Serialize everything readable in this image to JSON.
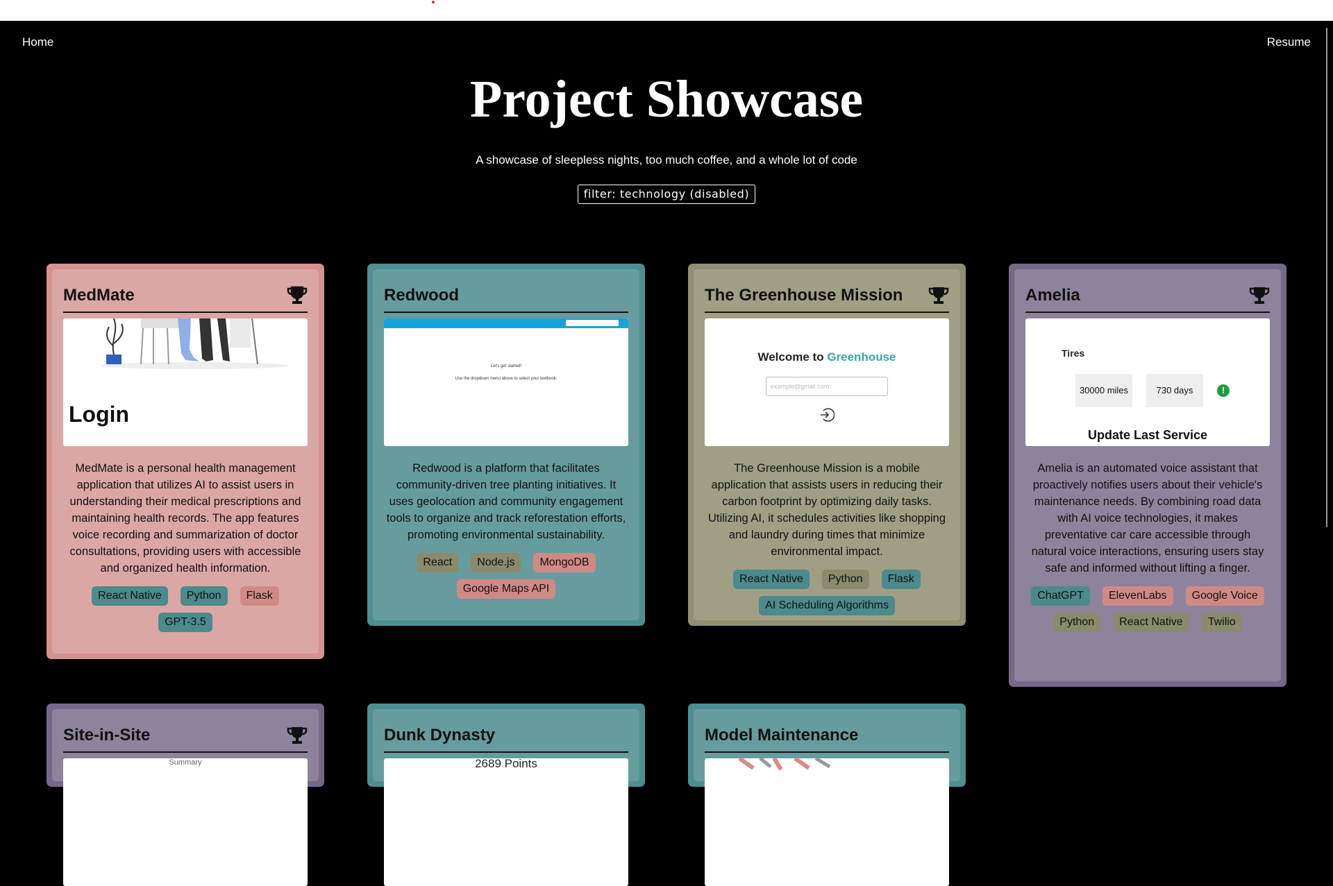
{
  "nav": {
    "home": "Home",
    "resume": "Resume"
  },
  "header": {
    "title": "Project Showcase",
    "subtitle": "A showcase of sleepless nights, too much coffee, and a whole lot of code",
    "filter": "filter: technology (disabled)"
  },
  "projects": [
    {
      "title": "MedMate",
      "award": true,
      "shot": {
        "text": "Login"
      },
      "description": "MedMate is a personal health management application that utilizes AI to assist users in understanding their medical prescriptions and maintaining health records. The app features voice recording and summarization of doctor consultations, providing users with accessible and organized health information.",
      "tags": [
        "React Native",
        "Python",
        "Flask",
        "GPT-3.5"
      ]
    },
    {
      "title": "Redwood",
      "award": false,
      "shot": {
        "line1": "Let's get started!",
        "line2": "Use the dropdown menu above to select your textbook."
      },
      "description": "Redwood is a platform that facilitates community-driven tree planting initiatives. It uses geolocation and community engagement tools to organize and track reforestation efforts, promoting environmental sustainability.",
      "tags": [
        "React",
        "Node.js",
        "MongoDB",
        "Google Maps API"
      ]
    },
    {
      "title": "The Greenhouse Mission",
      "award": true,
      "shot": {
        "welcome": "Welcome to",
        "brand": "Greenhouse",
        "placeholder": "example@gmail.com"
      },
      "description": "The Greenhouse Mission is a mobile application that assists users in reducing their carbon footprint by optimizing daily tasks. Utilizing AI, it schedules activities like shopping and laundry during times that minimize environmental impact.",
      "tags": [
        "React Native",
        "Python",
        "Flask",
        "AI Scheduling Algorithms"
      ]
    },
    {
      "title": "Amelia",
      "award": true,
      "shot": {
        "label": "Tires",
        "miles": "30000 miles",
        "days": "730 days",
        "alert": "!",
        "action": "Update Last Service"
      },
      "description": "Amelia is an automated voice assistant that proactively notifies users about their vehicle's maintenance needs. By combining road data with AI voice technologies, it makes preventative car care accessible through natural voice interactions, ensuring users stay safe and informed without lifting a finger.",
      "tags": [
        "ChatGPT",
        "ElevenLabs",
        "Google Voice",
        "Python",
        "React Native",
        "Twilio"
      ]
    },
    {
      "title": "Site-in-Site",
      "award": true,
      "shot": {
        "text": "Summary"
      }
    },
    {
      "title": "Dunk Dynasty",
      "award": false,
      "shot": {
        "text": "2689 Points"
      }
    },
    {
      "title": "Model Maintenance",
      "award": false,
      "shot": {}
    }
  ],
  "colors": {
    "pink": "#dba7a4",
    "teal": "#679c9f",
    "olive": "#a09f86",
    "purple": "#8e839c"
  }
}
